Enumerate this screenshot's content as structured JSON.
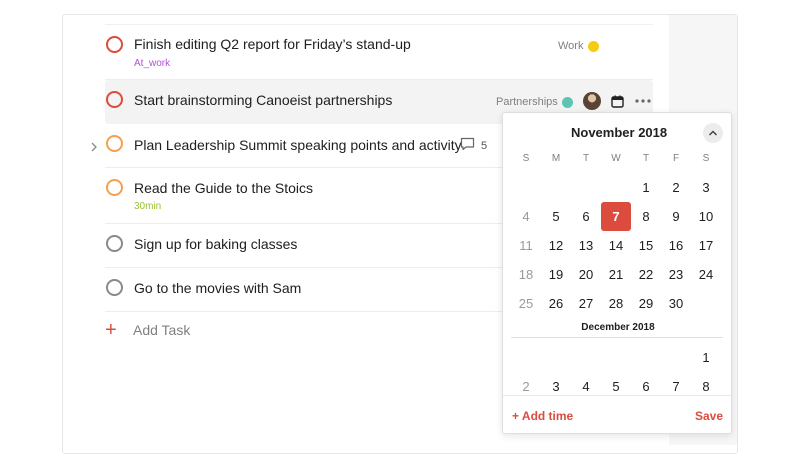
{
  "tasks": [
    {
      "title": "Finish editing Q2 report for Friday’s stand-up",
      "label": "At_work",
      "label_color": "#b34fe0",
      "project": "Work",
      "project_color": "#f3cc13",
      "priority_color": "#db4c3f"
    },
    {
      "title": "Start brainstorming Canoeist partnerships",
      "project": "Partnerships",
      "project_color": "#5ec3b3",
      "priority_color": "#db4c3f"
    },
    {
      "title": "Plan Leadership Summit speaking points and activity",
      "comments": "5",
      "priority_color": "#f5a050"
    },
    {
      "title": "Read the Guide to the Stoics",
      "label": "30min",
      "label_color": "#9ac22f",
      "priority_color": "#f5a050"
    },
    {
      "title": "Sign up for baking classes",
      "priority_color": "#808080"
    },
    {
      "title": "Go to the movies with Sam",
      "priority_color": "#808080"
    }
  ],
  "add_task": {
    "label": "Add Task"
  },
  "calendar": {
    "month": "November 2018",
    "weekdays": [
      "S",
      "M",
      "T",
      "W",
      "T",
      "F",
      "S"
    ],
    "selected_day": "7",
    "weeks": [
      [
        "",
        "",
        "",
        "",
        "1",
        "2",
        "3"
      ],
      [
        "4",
        "5",
        "6",
        "7",
        "8",
        "9",
        "10"
      ],
      [
        "11",
        "12",
        "13",
        "14",
        "15",
        "16",
        "17"
      ],
      [
        "18",
        "19",
        "20",
        "21",
        "22",
        "23",
        "24"
      ],
      [
        "25",
        "26",
        "27",
        "28",
        "29",
        "30",
        ""
      ]
    ],
    "past_days": [
      "4",
      "11",
      "18",
      "25"
    ],
    "next_month": "December 2018",
    "next_weeks": [
      [
        "",
        "",
        "",
        "",
        "",
        "",
        "1"
      ],
      [
        "2",
        "3",
        "4",
        "5",
        "6",
        "7",
        "8"
      ]
    ],
    "next_past_days": [
      "2"
    ],
    "add_time": "+ Add time",
    "save": "Save"
  },
  "colors": {
    "accent": "#db4c3f",
    "hover_row": "#f3f3f3"
  },
  "icons": [
    "chevron-right-icon",
    "comment-icon",
    "calendar-icon",
    "more-icon",
    "plus-icon",
    "chevron-up-icon"
  ]
}
